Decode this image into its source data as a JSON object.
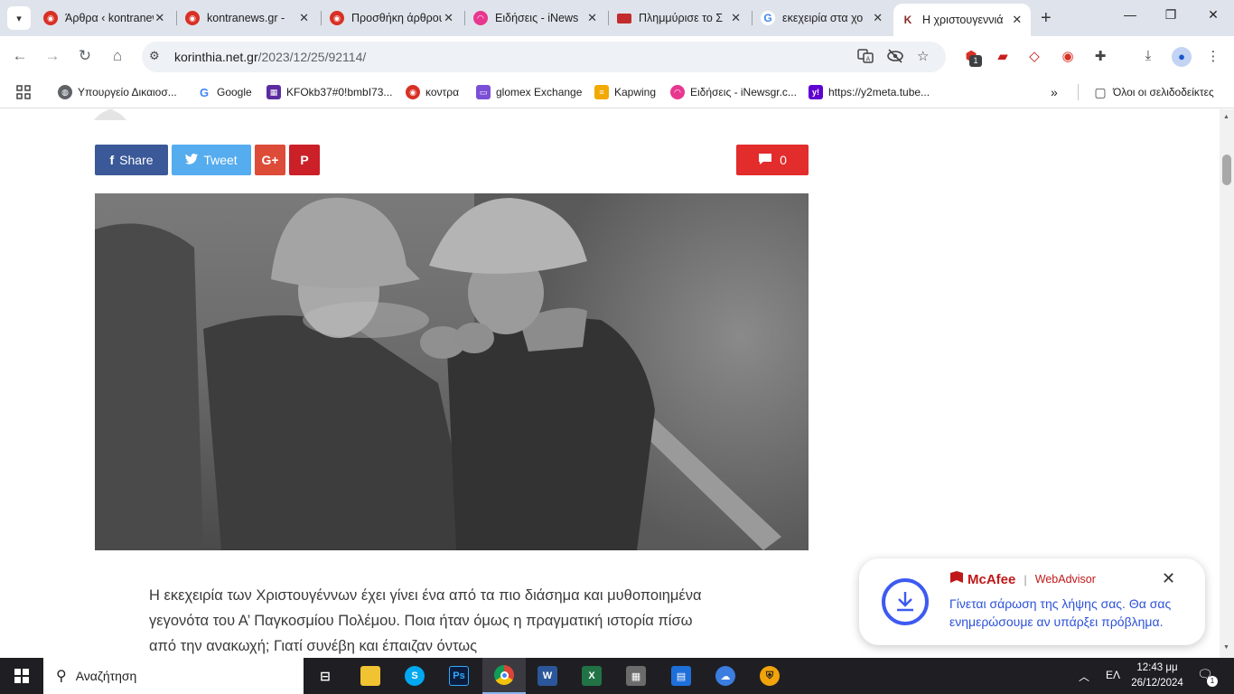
{
  "browser": {
    "tabs": [
      {
        "label": "Άρθρα ‹ kontranews",
        "favicon": "kontra-icon",
        "color": "#d93025"
      },
      {
        "label": "kontranews.gr - ",
        "favicon": "kontra-icon",
        "color": "#d93025"
      },
      {
        "label": "Προσθήκη άρθρου",
        "favicon": "kontra-icon",
        "color": "#d93025"
      },
      {
        "label": "Ειδήσεις - iNews",
        "favicon": "inews-icon",
        "color": "#e8378f"
      },
      {
        "label": "Πλημμύρισε το Σ",
        "favicon": "news-icon",
        "color": "#c22b2b"
      },
      {
        "label": "εκεχειρία στα χο",
        "favicon": "google-icon",
        "color": "#4285f4"
      },
      {
        "label": "Η χριστουγεννιά",
        "favicon": "korinthia-icon",
        "color": "#8b2a2a",
        "active": true
      }
    ],
    "url_domain": "korinthia.net.gr",
    "url_path": "/2023/12/25/92114/",
    "bookmarks": [
      {
        "label": "Υπουργείο Δικαιοσ...",
        "icon": "globe-icon",
        "color": "#5f6368"
      },
      {
        "label": "Google",
        "icon": "google-icon",
        "color": "#4285f4"
      },
      {
        "label": "KFOkb37#0!bmbI73...",
        "icon": "grid-icon",
        "color": "#5b2ca0"
      },
      {
        "label": "κοντρα",
        "icon": "kontra-icon",
        "color": "#d93025"
      },
      {
        "label": "glomex Exchange",
        "icon": "glomex-icon",
        "color": "#7b4fd6"
      },
      {
        "label": "Kapwing",
        "icon": "kapwing-icon",
        "color": "#f2a900"
      },
      {
        "label": "Ειδήσεις - iNewsgr.c...",
        "icon": "inews-icon",
        "color": "#e8378f"
      },
      {
        "label": "https://y2meta.tube...",
        "icon": "yahoo-icon",
        "color": "#5f01d1"
      }
    ],
    "all_bookmarks": "Όλοι οι σελιδοδείκτες"
  },
  "share": {
    "facebook": "Share",
    "twitter": "Tweet",
    "gplus": "G+",
    "pinterest": "P",
    "comments": "0"
  },
  "article": {
    "text": "Η εκεχειρία των Χριστουγέννων έχει γίνει ένα από τα πιο διάσημα και μυθοποιημένα γεγονότα του Α’ Παγκοσμίου Πολέμου. Ποια ήταν όμως η πραγματική ιστορία πίσω από την ανακωχή; Γιατί συνέβη και έπαιζαν όντως"
  },
  "mcafee": {
    "brand": "McAfee",
    "product": "WebAdvisor",
    "message": "Γίνεται σάρωση της λήψης σας. Θα σας ενημερώσουμε αν υπάρξει πρόβλημα."
  },
  "taskbar": {
    "search_placeholder": "Αναζήτηση",
    "language": "ΕΛ",
    "time": "12:43 μμ",
    "date": "26/12/2024",
    "notifications": "1"
  }
}
